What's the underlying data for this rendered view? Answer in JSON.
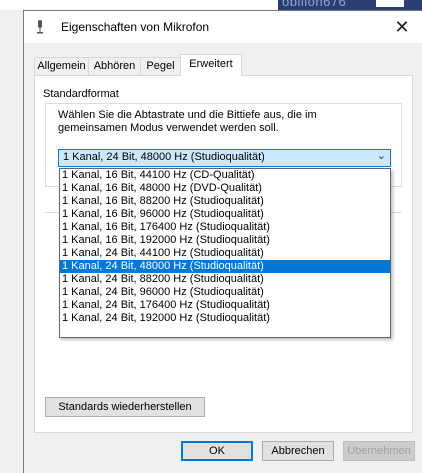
{
  "dialog": {
    "title": "Eigenschaften von Mikrofon",
    "close_glyph": "✕",
    "tabs": [
      {
        "label": "Allgemein"
      },
      {
        "label": "Abhören"
      },
      {
        "label": "Pegel"
      },
      {
        "label": "Erweitert"
      }
    ],
    "active_tab": "Erweitert"
  },
  "background": {
    "window_fragment_text": "obilion676"
  },
  "standard_format": {
    "group_label": "Standardformat",
    "description": "Wählen Sie die Abtastrate und die Bittiefe aus, die im gemeinsamen Modus verwendet werden soll.",
    "selected_value": "1 Kanal, 24 Bit, 48000 Hz (Studioqualität)",
    "options": [
      "1 Kanal, 16 Bit, 44100 Hz (CD-Qualität)",
      "1 Kanal, 16 Bit, 48000 Hz (DVD-Qualität)",
      "1 Kanal, 16 Bit, 88200 Hz (Studioqualität)",
      "1 Kanal, 16 Bit, 96000 Hz (Studioqualität)",
      "1 Kanal, 16 Bit, 176400 Hz (Studioqualität)",
      "1 Kanal, 16 Bit, 192000 Hz (Studioqualität)",
      "1 Kanal, 24 Bit, 44100 Hz (Studioqualität)",
      "1 Kanal, 24 Bit, 48000 Hz (Studioqualität)",
      "1 Kanal, 24 Bit, 88200 Hz (Studioqualität)",
      "1 Kanal, 24 Bit, 96000 Hz (Studioqualität)",
      "1 Kanal, 24 Bit, 176400 Hz (Studioqualität)",
      "1 Kanal, 24 Bit, 192000 Hz (Studioqualität)"
    ],
    "selected_index": 7
  },
  "buttons": {
    "restore_defaults": "Standards wiederherstellen",
    "ok": "OK",
    "cancel": "Abbrechen",
    "apply": "Übernehmen"
  },
  "colors": {
    "accent": "#0078d7",
    "combo_bg": "#cce8ff"
  }
}
